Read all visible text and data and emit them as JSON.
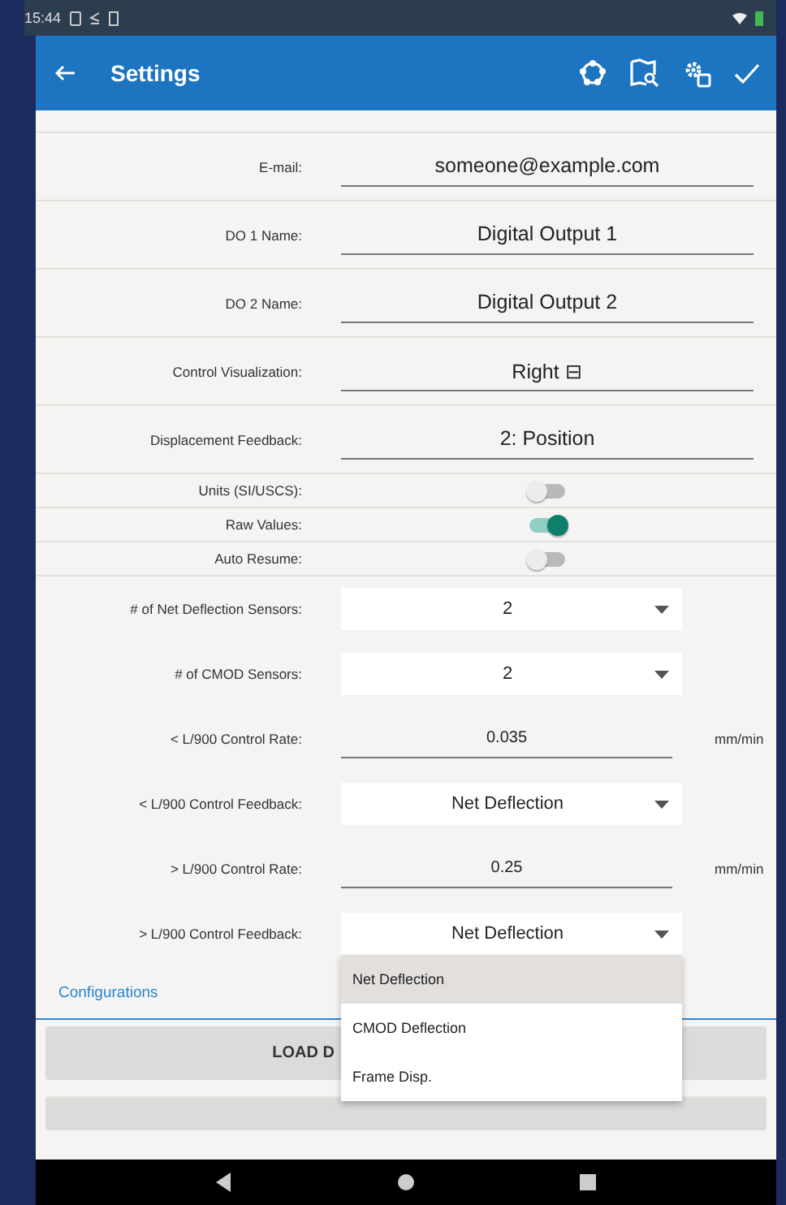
{
  "status_bar": {
    "time": "15:44"
  },
  "app_bar": {
    "title": "Settings"
  },
  "settings": [
    {
      "kind": "text",
      "label": "E-mail:",
      "value": "someone@example.com"
    },
    {
      "kind": "text",
      "label": "DO 1 Name:",
      "value": "Digital Output 1"
    },
    {
      "kind": "text",
      "label": "DO 2 Name:",
      "value": "Digital Output 2"
    },
    {
      "kind": "text",
      "label": "Control Visualization:",
      "value": "Right ⊟"
    },
    {
      "kind": "text",
      "label": "Displacement Feedback:",
      "value": "2: Position"
    },
    {
      "kind": "toggle",
      "label": "Units (SI/USCS):",
      "on": false
    },
    {
      "kind": "toggle",
      "label": "Raw Values:",
      "on": true
    },
    {
      "kind": "toggle",
      "label": "Auto Resume:",
      "on": false
    },
    {
      "kind": "spinner",
      "label": "# of Net Deflection Sensors:",
      "value": "2"
    },
    {
      "kind": "spinner",
      "label": "# of CMOD Sensors:",
      "value": "2"
    },
    {
      "kind": "rate",
      "label": "< L/900 Control Rate:",
      "value": "0.035",
      "unit": "mm/min"
    },
    {
      "kind": "spinner",
      "label": "< L/900 Control Feedback:",
      "value": "Net Deflection"
    },
    {
      "kind": "rate",
      "label": "> L/900 Control Rate:",
      "value": "0.25",
      "unit": "mm/min"
    },
    {
      "kind": "spinner",
      "label": "> L/900 Control Feedback:",
      "value": "Net Deflection",
      "open": true
    }
  ],
  "dropdown_options": [
    {
      "label": "Net Deflection",
      "selected": true
    },
    {
      "label": "CMOD Deflection",
      "selected": false
    },
    {
      "label": "Frame Disp.",
      "selected": false
    }
  ],
  "tabs": [
    {
      "label": "Configurations",
      "selected": true
    }
  ],
  "buttons": [
    "LOAD D"
  ]
}
